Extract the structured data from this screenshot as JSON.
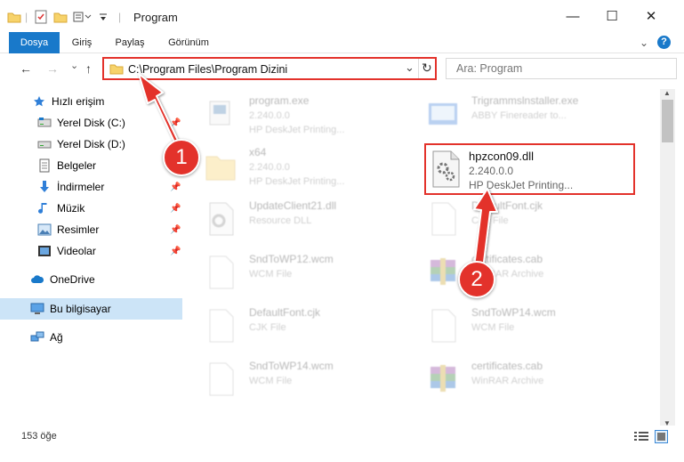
{
  "window": {
    "title": "Program",
    "minimize_glyph": "—",
    "maximize_glyph": "☐",
    "close_glyph": "✕"
  },
  "ribbon": {
    "tabs": [
      {
        "label": "Dosya"
      },
      {
        "label": "Giriş"
      },
      {
        "label": "Paylaş"
      },
      {
        "label": "Görünüm"
      }
    ],
    "help_glyph": "?",
    "expand_glyph": "⌄"
  },
  "navigation": {
    "back_glyph": "←",
    "forward_glyph": "→",
    "recent_glyph": "⌄",
    "up_glyph": "↑"
  },
  "address": {
    "path": "C:\\Program Files\\Program Dizini",
    "dropdown_glyph": "⌄",
    "refresh_glyph": "↻"
  },
  "search": {
    "placeholder": "Ara: Program"
  },
  "sidebar": {
    "items": [
      {
        "label": "Hızlı erişim",
        "icon": "star-icon",
        "pinned": false
      },
      {
        "label": "Yerel Disk (C:)",
        "icon": "drive-icon",
        "pinned": true
      },
      {
        "label": "Yerel Disk (D:)",
        "icon": "drive-icon",
        "pinned": true
      },
      {
        "label": "Belgeler",
        "icon": "documents-icon",
        "pinned": true
      },
      {
        "label": "İndirmeler",
        "icon": "download-icon",
        "pinned": true
      },
      {
        "label": "Müzik",
        "icon": "music-icon",
        "pinned": true
      },
      {
        "label": "Resimler",
        "icon": "pictures-icon",
        "pinned": true
      },
      {
        "label": "Videolar",
        "icon": "videos-icon",
        "pinned": true
      },
      {
        "label": "OneDrive",
        "icon": "cloud-icon",
        "pinned": false
      },
      {
        "label": "Bu bilgisayar",
        "icon": "computer-icon",
        "pinned": false
      },
      {
        "label": "Ağ",
        "icon": "network-icon",
        "pinned": false
      }
    ],
    "pin_glyph": "📌"
  },
  "files": [
    {
      "name": "program.exe",
      "line1": "2.240.0.0",
      "line2": "HP DeskJet Printing...",
      "icon": "exe-icon"
    },
    {
      "name": "Trigrammslnstaller.exe",
      "line1": "ABBY Finereader to...",
      "line2": "",
      "icon": "installer-icon"
    },
    {
      "name": "x64",
      "line1": "2.240.0.0",
      "line2": "HP DeskJet Printing...",
      "icon": "folder-icon"
    },
    {
      "name": "hpzcon09.dll",
      "line1": "2.240.0.0",
      "line2": "HP DeskJet Printing...",
      "icon": "dll-gear-icon"
    },
    {
      "name": "UpdateClient21.dll",
      "line1": "Resource DLL",
      "line2": "",
      "icon": "dll-gear-icon"
    },
    {
      "name": "DefaultFont.cjk",
      "line1": "CJK File",
      "line2": "",
      "icon": "file-icon"
    },
    {
      "name": "SndToWP12.wcm",
      "line1": "WCM File",
      "line2": "",
      "icon": "file-icon"
    },
    {
      "name": "certificates.cab",
      "line1": "WinRAR Archive",
      "line2": "",
      "icon": "archive-icon"
    },
    {
      "name": "DefaultFont.cjk",
      "line1": "CJK File",
      "line2": "",
      "icon": "file-icon"
    },
    {
      "name": "SndToWP14.wcm",
      "line1": "WCM File",
      "line2": "",
      "icon": "file-icon"
    },
    {
      "name": "SndToWP14.wcm",
      "line1": "WCM File",
      "line2": "",
      "icon": "file-icon"
    },
    {
      "name": "certificates.cab",
      "line1": "WinRAR Archive",
      "line2": "",
      "icon": "archive-icon"
    }
  ],
  "status": {
    "item_count": "153 öğe"
  },
  "annotations": {
    "step1": "1",
    "step2": "2",
    "color": "#e3322b"
  }
}
